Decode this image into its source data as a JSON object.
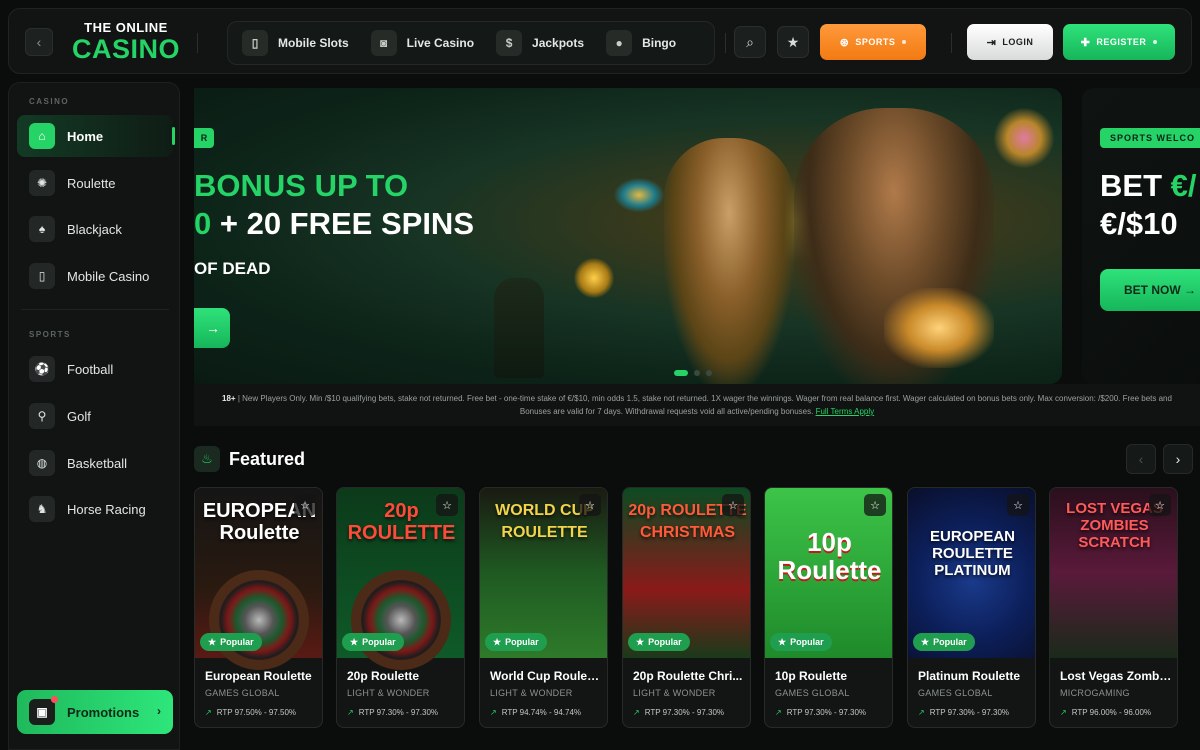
{
  "header": {
    "back_icon": "chevron-left-icon",
    "logo_top": "THE ONLINE",
    "logo_main": "CASINO",
    "nav": [
      {
        "label": "Mobile Slots",
        "icon": "phone-slot-icon"
      },
      {
        "label": "Live Casino",
        "icon": "camera-icon"
      },
      {
        "label": "Jackpots",
        "icon": "money-bag-icon"
      },
      {
        "label": "Bingo",
        "icon": "bingo-ball-icon"
      }
    ],
    "search_icon": "search-icon",
    "star_icon": "star-icon",
    "sports_label": "SPORTS",
    "login_label": "LOGIN",
    "register_label": "REGISTER",
    "colors": {
      "brand": "#25d366",
      "sports": "#f58a22"
    }
  },
  "sidebar": {
    "casino_heading": "CASINO",
    "casino_items": [
      {
        "label": "Home",
        "icon": "home-icon",
        "active": true
      },
      {
        "label": "Roulette",
        "icon": "roulette-icon"
      },
      {
        "label": "Blackjack",
        "icon": "cards-icon"
      },
      {
        "label": "Mobile Casino",
        "icon": "phone-icon"
      }
    ],
    "sports_heading": "SPORTS",
    "sports_items": [
      {
        "label": "Football",
        "icon": "football-icon"
      },
      {
        "label": "Golf",
        "icon": "golf-icon"
      },
      {
        "label": "Basketball",
        "icon": "basketball-icon"
      },
      {
        "label": "Horse Racing",
        "icon": "horse-icon"
      }
    ],
    "promotions_label": "Promotions"
  },
  "banner": {
    "tag": "R",
    "line1": "BONUS UP TO",
    "line2_green": "0",
    "line2_white": " + 20 FREE SPINS",
    "line3": "OF DEAD",
    "cta_arrow": "→",
    "next_tag": "SPORTS WELCO",
    "next_line1_white": "BET ",
    "next_line1_green": "€/",
    "next_line2": "€/$10",
    "next_cta": "BET NOW →"
  },
  "terms": {
    "age": "18+",
    "text": " | New Players Only. Min /$10 qualifying bets, stake not returned. Free bet - one-time stake of €/$10, min odds 1.5, stake not returned. 1X wager the winnings. Wager from real balance first. Wager calculated on bonus bets only. Max conversion: /$200. Free bets and Bonuses are valid for 7 days. Withdrawal requests void all active/pending bonuses. ",
    "link": "Full Terms Apply"
  },
  "featured": {
    "title": "Featured",
    "popular_label": "Popular",
    "games": [
      {
        "name": "European Roulette",
        "provider": "GAMES GLOBAL",
        "rtp": "RTP 97.50% - 97.50%",
        "art": "EUROPEAN Roulette",
        "bg": "#1a1a1a"
      },
      {
        "name": "20p Roulette",
        "provider": "LIGHT & WONDER",
        "rtp": "RTP 97.30% - 97.30%",
        "art": "20p ROULETTE",
        "bg": "#0e4a22"
      },
      {
        "name": "World Cup Roulett...",
        "provider": "LIGHT & WONDER",
        "rtp": "RTP 94.74% - 94.74%",
        "art": "WORLD CUP ROULETTE",
        "bg": "#1d4a1f"
      },
      {
        "name": "20p Roulette Chri...",
        "provider": "LIGHT & WONDER",
        "rtp": "RTP 97.30% - 97.30%",
        "art": "20p ROULETTE CHRISTMAS",
        "bg": "#0f5a2c"
      },
      {
        "name": "10p Roulette",
        "provider": "GAMES GLOBAL",
        "rtp": "RTP 97.30% - 97.30%",
        "art": "10p Roulette",
        "bg": "#2fa83a"
      },
      {
        "name": "Platinum Roulette",
        "provider": "GAMES GLOBAL",
        "rtp": "RTP 97.30% - 97.30%",
        "art": "EUROPEAN ROULETTE PLATINUM",
        "bg": "#0f2a6a"
      },
      {
        "name": "Lost Vegas Zombi...",
        "provider": "MICROGAMING",
        "rtp": "RTP 96.00% - 96.00%",
        "art": "LOST VEGAS ZOMBIES SCRATCH",
        "bg": "#3a1226"
      }
    ]
  }
}
